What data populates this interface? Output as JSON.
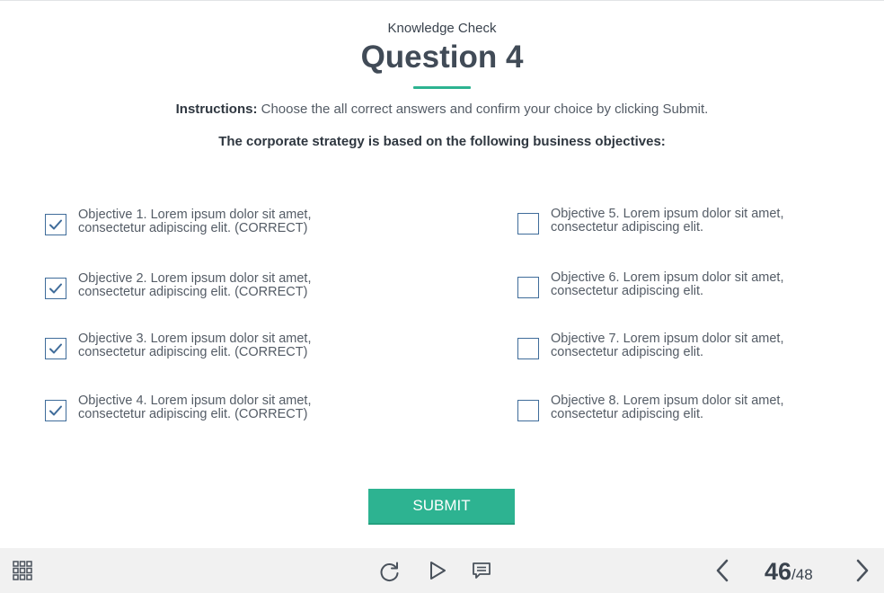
{
  "header": {
    "subtitle": "Knowledge Check",
    "title": "Question 4"
  },
  "instructions": {
    "label": "Instructions:",
    "text": " Choose the all correct answers and confirm your choice by clicking Submit."
  },
  "question": "The corporate strategy is based on the following business objectives:",
  "options": [
    {
      "line1": "Objective 1. Lorem ipsum dolor sit amet,",
      "line2": "consectetur adipiscing elit. (CORRECT)",
      "checked": true
    },
    {
      "line1": "Objective 2. Lorem ipsum dolor sit amet,",
      "line2": "consectetur adipiscing elit. (CORRECT)",
      "checked": true
    },
    {
      "line1": "Objective 3. Lorem ipsum dolor sit amet,",
      "line2": "consectetur adipiscing elit. (CORRECT)",
      "checked": true
    },
    {
      "line1": "Objective 4. Lorem ipsum dolor sit amet,",
      "line2": "consectetur adipiscing elit. (CORRECT)",
      "checked": true
    },
    {
      "line1": "Objective 5. Lorem ipsum dolor sit amet,",
      "line2": "consectetur adipiscing elit.",
      "checked": false
    },
    {
      "line1": "Objective 6. Lorem ipsum dolor sit amet,",
      "line2": "consectetur adipiscing elit.",
      "checked": false
    },
    {
      "line1": "Objective 7. Lorem ipsum dolor sit amet,",
      "line2": "consectetur adipiscing elit.",
      "checked": false
    },
    {
      "line1": "Objective 8. Lorem ipsum dolor sit amet,",
      "line2": "consectetur adipiscing elit.",
      "checked": false
    }
  ],
  "submit_label": "SUBMIT",
  "toolbar": {
    "menu_icon": "grid-menu-icon",
    "replay_icon": "replay-icon",
    "play_icon": "play-icon",
    "notes_icon": "notes-icon",
    "prev_icon": "chevron-left-icon",
    "next_icon": "chevron-right-icon",
    "current_page": "46",
    "total_pages": "/48"
  },
  "colors": {
    "accent": "#2db391",
    "checkbox_border": "#3f6c9a",
    "title": "#414b57",
    "toolbar_bg": "#f1f1f1"
  }
}
